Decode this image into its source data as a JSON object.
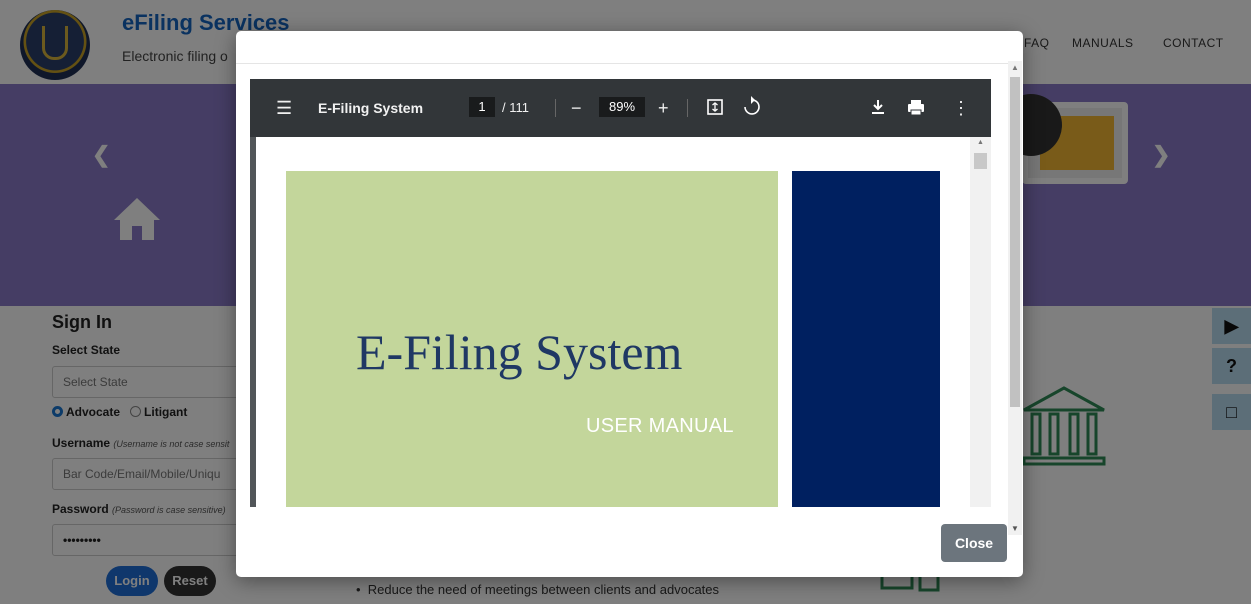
{
  "header": {
    "title": "eFiling Services",
    "subtitle": "Electronic filing o",
    "nav": [
      "FAQ",
      "MANUALS",
      "CONTACT"
    ]
  },
  "signin": {
    "heading": "Sign In",
    "select_state_label": "Select State",
    "select_state_value": "Select State",
    "radio_advocate": "Advocate",
    "radio_litigant": "Litigant",
    "username_label": "Username",
    "username_note": "(Username is not case sensit",
    "username_placeholder": "Bar Code/Email/Mobile/Uniqu",
    "password_label": "Password",
    "password_note": "(Password is case sensitive)",
    "password_value": "•••••••••",
    "login_label": "Login",
    "reset_label": "Reset"
  },
  "content": {
    "bullet": "Reduce the need of meetings between clients and advocates"
  },
  "pdf_viewer": {
    "title": "E-Filing System",
    "current_page": "1",
    "total_pages": "/ 111",
    "zoom": "89%",
    "document_title": "E-Filing System",
    "document_subtitle": "USER MANUAL"
  },
  "modal": {
    "close_label": "Close"
  },
  "colors": {
    "accent": "#1565c0",
    "banner": "#8a7ac8",
    "doc_green": "#c3d69b",
    "doc_navy": "#002060",
    "close_button": "#6c757d"
  }
}
